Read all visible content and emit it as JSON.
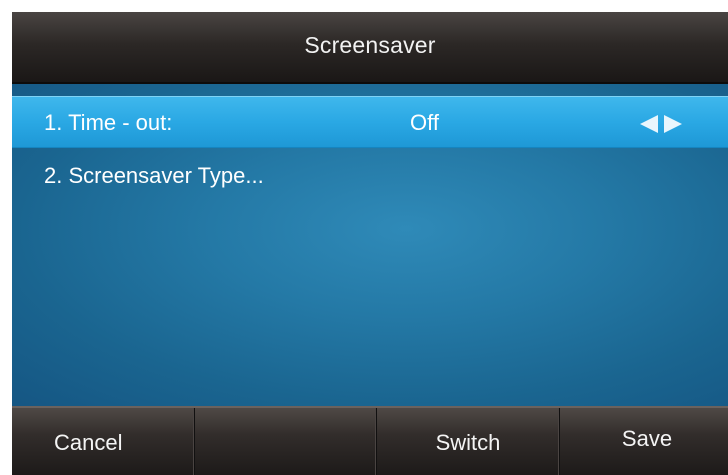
{
  "title": "Screensaver",
  "menu": {
    "items": [
      {
        "label": "1. Time - out:",
        "value": "Off",
        "selected": true
      },
      {
        "label": "2. Screensaver Type...",
        "selected": false
      }
    ]
  },
  "softkeys": [
    {
      "label": "Cancel"
    },
    {
      "label": ""
    },
    {
      "label": "Switch"
    },
    {
      "label": "Save"
    }
  ],
  "icons": {
    "left": "triangle-left-icon",
    "right": "triangle-right-icon"
  },
  "colors": {
    "title_bar": "#2c2826",
    "content_bg": "#2479a6",
    "selected_row": "#2aa8e4",
    "softkey_bar": "#322d2b",
    "text": "#ffffff"
  }
}
